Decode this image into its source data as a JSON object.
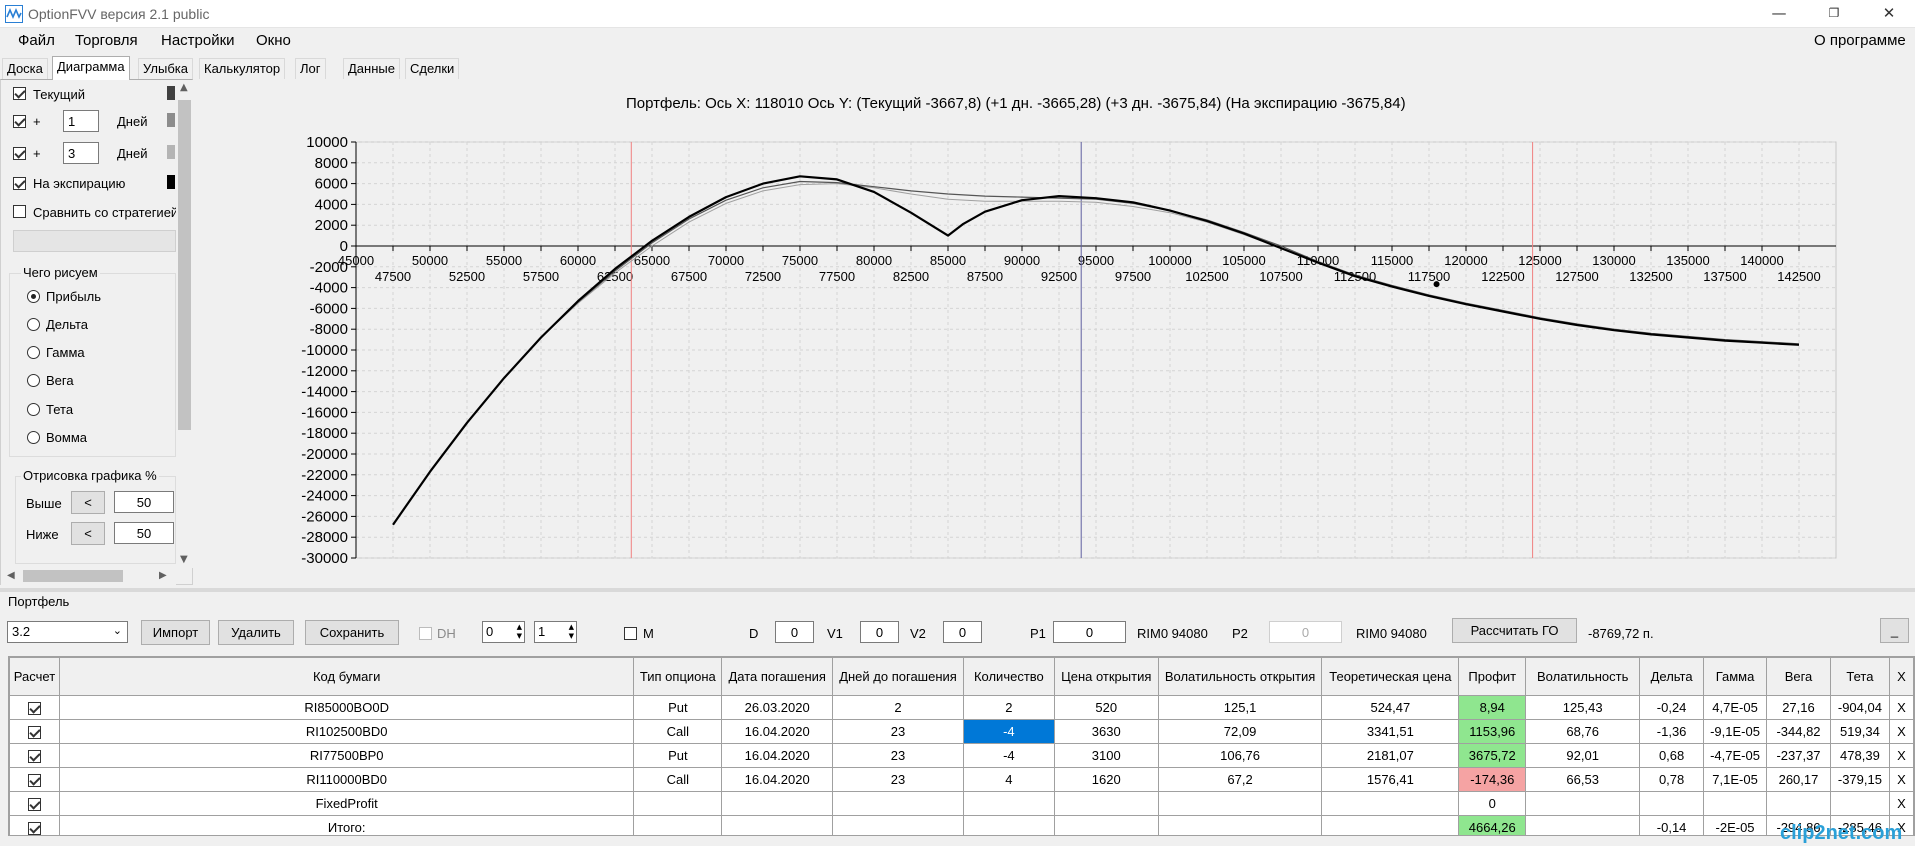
{
  "window": {
    "title": "OptionFVV версия 2.1 public",
    "minimize_glyph": "—",
    "maximize_glyph": "❐",
    "close_glyph": "✕"
  },
  "menu": {
    "items": [
      "Файл",
      "Торговля",
      "Настройки",
      "Окно"
    ],
    "about": "О программе"
  },
  "tabs": [
    "Доска",
    "Диаграмма",
    "Улыбка",
    "Калькулятор",
    "Лог",
    "Данные",
    "Сделки"
  ],
  "active_tab": "Диаграмма",
  "left": {
    "current_label": "Текущий",
    "plus_label": "+",
    "days_label": "Дней",
    "plus1_value": "1",
    "plus3_value": "3",
    "expiry_label": "На экспирацию",
    "compare_label": "Сравнить со стратегией",
    "draw_group": "Чего рисуем",
    "radios": [
      "Прибыль",
      "Дельта",
      "Гамма",
      "Вега",
      "Тета",
      "Вомма"
    ],
    "selected_radio": "Прибыль",
    "render_group": "Отрисовка графика %",
    "above_label": "Выше",
    "below_label": "Ниже",
    "lt_button": "<",
    "above_value": "50",
    "below_value": "50",
    "swatch_colors": [
      "#404040",
      "#8c8c8c",
      "#b4b4b4",
      "#000000"
    ]
  },
  "chart_title": "Портфель: Ось X: 118010 Ось Y:  (Текущий -3667,8)  (+1 дн. -3665,28)  (+3 дн. -3675,84)  (На экспирацию -3675,84)",
  "chart_data": {
    "type": "line",
    "title": "Портфель: Ось X: 118010 Ось Y:  (Текущий -3667,8)  (+1 дн. -3665,28)  (+3 дн. -3675,84)  (На экспирацию -3675,84)",
    "xlim": [
      45000,
      145000
    ],
    "ylim": [
      -30000,
      10000
    ],
    "x_ticks_upper": [
      45000,
      50000,
      55000,
      60000,
      65000,
      70000,
      75000,
      80000,
      85000,
      90000,
      95000,
      100000,
      105000,
      110000,
      115000,
      120000,
      125000,
      130000,
      135000,
      140000
    ],
    "x_ticks_lower": [
      47500,
      52500,
      57500,
      62500,
      67500,
      72500,
      77500,
      82500,
      87500,
      92500,
      97500,
      102500,
      107500,
      112500,
      117500,
      122500,
      127500,
      132500,
      137500,
      142500
    ],
    "y_ticks": [
      10000,
      8000,
      6000,
      4000,
      2000,
      0,
      -2000,
      -4000,
      -6000,
      -8000,
      -10000,
      -12000,
      -14000,
      -16000,
      -18000,
      -20000,
      -22000,
      -24000,
      -26000,
      -28000,
      -30000
    ],
    "grid": true,
    "vlines": [
      {
        "x": 63600,
        "color": "#f08080"
      },
      {
        "x": 94000,
        "color": "#6060a0"
      },
      {
        "x": 124500,
        "color": "#f08080"
      }
    ],
    "marker": {
      "x": 118010,
      "y": -3668
    },
    "series": [
      {
        "color": "#000000",
        "width": 2.2,
        "x": [
          47500,
          50000,
          52500,
          55000,
          57500,
          60000,
          62500,
          65000,
          67500,
          70000,
          72500,
          75000,
          77500,
          80000,
          82500,
          85000,
          86000,
          87500,
          90000,
          92500,
          95000,
          97500,
          100000,
          102500,
          105000,
          107500,
          110000,
          112500,
          115000,
          117500,
          120000,
          122500,
          125000,
          127500,
          130000,
          132500,
          135000,
          137500,
          140000,
          142500
        ],
        "y": [
          -26800,
          -21700,
          -17000,
          -12700,
          -8800,
          -5300,
          -2200,
          500,
          2800,
          4700,
          6000,
          6700,
          6400,
          5200,
          3200,
          1000,
          2100,
          3300,
          4400,
          4800,
          4600,
          4200,
          3400,
          2400,
          1200,
          -200,
          -1600,
          -2900,
          -3900,
          -4800,
          -5600,
          -6300,
          -7000,
          -7600,
          -8100,
          -8500,
          -8800,
          -9100,
          -9300,
          -9500
        ]
      },
      {
        "color": "#555555",
        "width": 1.2,
        "x": [
          47500,
          50000,
          52500,
          55000,
          57500,
          60000,
          62500,
          65000,
          67500,
          70000,
          72500,
          75000,
          77500,
          80000,
          82500,
          85000,
          87500,
          90000,
          92500,
          95000,
          97500,
          100000,
          102500,
          105000,
          107500,
          110000,
          112500,
          115000,
          117500,
          120000,
          122500,
          125000,
          127500,
          130000,
          132500,
          135000,
          137500,
          140000,
          142500
        ],
        "y": [
          -26800,
          -21700,
          -17000,
          -12700,
          -8800,
          -5400,
          -2400,
          300,
          2600,
          4400,
          5600,
          6200,
          6100,
          5700,
          5300,
          5000,
          4800,
          4700,
          4600,
          4500,
          4100,
          3400,
          2500,
          1300,
          0,
          -1500,
          -2800,
          -3800,
          -4700,
          -5500,
          -6200,
          -6900,
          -7500,
          -8000,
          -8400,
          -8700,
          -9000,
          -9200,
          -9400
        ]
      },
      {
        "color": "#a0a0a0",
        "width": 1.0,
        "x": [
          47500,
          50000,
          52500,
          55000,
          57500,
          60000,
          62500,
          65000,
          67500,
          70000,
          72500,
          75000,
          77500,
          80000,
          82500,
          85000,
          87500,
          90000,
          92500,
          95000,
          97500,
          100000,
          102500,
          105000,
          107500,
          110000,
          112500,
          115000,
          117500,
          120000,
          122500,
          125000,
          127500,
          130000,
          132500,
          135000,
          137500,
          140000,
          142500
        ],
        "y": [
          -26800,
          -21700,
          -17000,
          -12700,
          -8800,
          -5500,
          -2600,
          0,
          2300,
          4100,
          5300,
          5900,
          6000,
          5600,
          5000,
          4500,
          4300,
          4300,
          4300,
          4200,
          3800,
          3200,
          2300,
          1100,
          -200,
          -1600,
          -2900,
          -3900,
          -4800,
          -5600,
          -6300,
          -7000,
          -7600,
          -8100,
          -8500,
          -8800,
          -9100,
          -9300,
          -9500
        ]
      }
    ]
  },
  "portfolio": {
    "label": "Портфель",
    "select_value": "3.2",
    "import_button": "Импорт",
    "delete_button": "Удалить",
    "save_button": "Сохранить",
    "dh_label": "DH",
    "spin1": "0",
    "spin2": "1",
    "m_label": "M",
    "d_label": "D",
    "d_value": "0",
    "v1_label": "V1",
    "v1_value": "0",
    "v2_label": "V2",
    "v2_value": "0",
    "p1_label": "P1",
    "p1_value": "0",
    "rim1": "RIM0 94080",
    "p2_label": "P2",
    "p2_value": "0",
    "rim2": "RIM0 94080",
    "calc_go_button": "Рассчитать ГО",
    "go_value": "-8769,72 п.",
    "small_button": "_"
  },
  "table": {
    "headers": [
      "Расчет",
      "Код бумаги",
      "Тип опциона",
      "Дата погашения",
      "Дней до погашения",
      "Количество",
      "Цена открытия",
      "Волатильность открытия",
      "Теоретическая цена",
      "Профит",
      "Волатильность",
      "Дельта",
      "Гамма",
      "Вега",
      "Тета",
      "X"
    ],
    "rows": [
      {
        "checked": true,
        "code": "RI85000BO0D",
        "type": "Put",
        "date": "26.03.2020",
        "days": "2",
        "qty": "2",
        "open": "520",
        "vol_open": "125,1",
        "theo": "524,47",
        "profit": "8,94",
        "profit_style": "green",
        "vol": "125,43",
        "delta": "-0,24",
        "gamma": "4,7E-05",
        "vega": "27,16",
        "theta": "-904,04",
        "x": "X"
      },
      {
        "checked": true,
        "code": "RI102500BD0",
        "type": "Call",
        "date": "16.04.2020",
        "days": "23",
        "qty": "-4",
        "qty_selected": true,
        "open": "3630",
        "vol_open": "72,09",
        "theo": "3341,51",
        "profit": "1153,96",
        "profit_style": "green",
        "vol": "68,76",
        "delta": "-1,36",
        "gamma": "-9,1E-05",
        "vega": "-344,82",
        "theta": "519,34",
        "x": "X"
      },
      {
        "checked": true,
        "code": "RI77500BP0",
        "type": "Put",
        "date": "16.04.2020",
        "days": "23",
        "qty": "-4",
        "open": "3100",
        "vol_open": "106,76",
        "theo": "2181,07",
        "profit": "3675,72",
        "profit_style": "green",
        "vol": "92,01",
        "delta": "0,68",
        "gamma": "-4,7E-05",
        "vega": "-237,37",
        "theta": "478,39",
        "x": "X"
      },
      {
        "checked": true,
        "code": "RI110000BD0",
        "type": "Call",
        "date": "16.04.2020",
        "days": "23",
        "qty": "4",
        "open": "1620",
        "vol_open": "67,2",
        "theo": "1576,41",
        "profit": "-174,36",
        "profit_style": "red",
        "vol": "66,53",
        "delta": "0,78",
        "gamma": "7,1E-05",
        "vega": "260,17",
        "theta": "-379,15",
        "x": "X"
      },
      {
        "checked": true,
        "code": "FixedProfit",
        "type": "",
        "date": "",
        "days": "",
        "qty": "",
        "open": "",
        "vol_open": "",
        "theo": "",
        "profit": "0",
        "profit_style": "",
        "vol": "",
        "delta": "",
        "gamma": "",
        "vega": "",
        "theta": "",
        "x": "X"
      },
      {
        "checked": true,
        "code": "Итого:",
        "type": "",
        "date": "",
        "days": "",
        "qty": "",
        "open": "",
        "vol_open": "",
        "theo": "",
        "profit": "4664,26",
        "profit_style": "green",
        "vol": "",
        "delta": "-0,14",
        "gamma": "-2E-05",
        "vega": "-294,86",
        "theta": "-285,46",
        "x": "X"
      }
    ]
  },
  "watermark": "clip2net.com"
}
